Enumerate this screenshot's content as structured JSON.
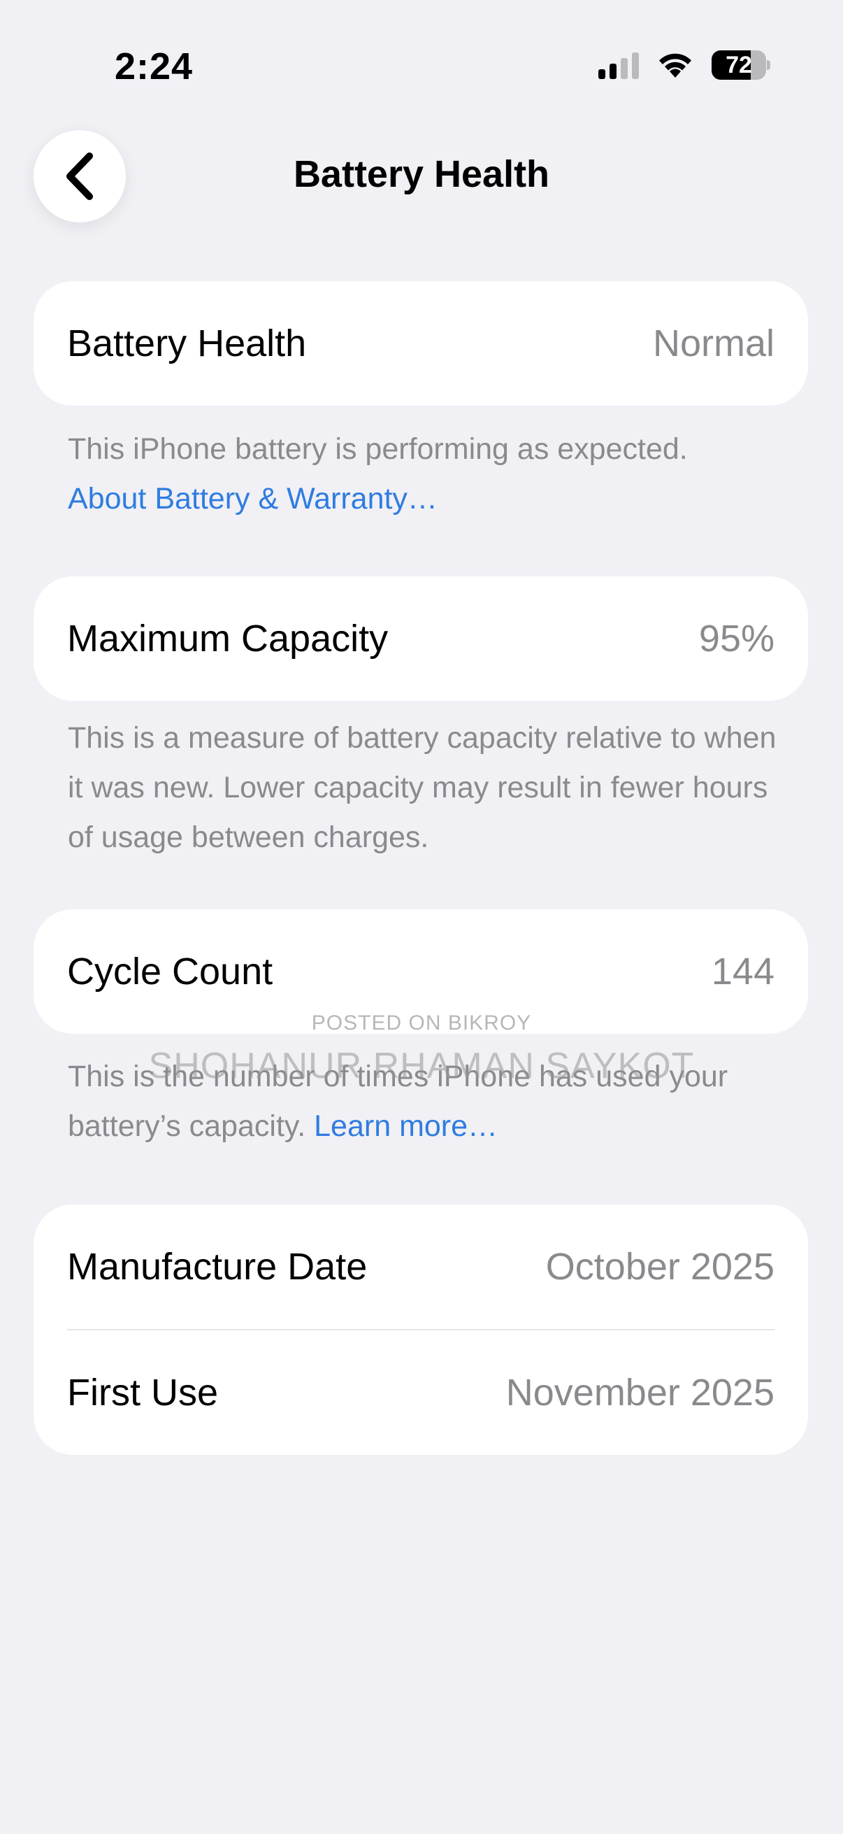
{
  "status_bar": {
    "time": "2:24",
    "battery_level": "72",
    "signal_bars": 4,
    "signal_active": 2
  },
  "nav": {
    "back_icon": "chevron-left-icon",
    "title": "Battery Health"
  },
  "battery_health": {
    "label": "Battery Health",
    "value": "Normal",
    "footnote": "This iPhone battery is performing as expected.",
    "link": "About Battery & Warranty…"
  },
  "max_capacity": {
    "label": "Maximum Capacity",
    "value": "95%",
    "footnote": "This is a measure of battery capacity relative to when it was new. Lower capacity may result in fewer hours of usage between charges."
  },
  "cycle_count": {
    "label": "Cycle Count",
    "value": "144",
    "footnote": "This is the number of times iPhone has used your battery’s capacity.",
    "link": "Learn more…"
  },
  "dates": {
    "manufacture_label": "Manufacture Date",
    "manufacture_value": "October 2025",
    "first_use_label": "First Use",
    "first_use_value": "November 2025"
  },
  "watermark": {
    "small": "POSTED ON BIKROY",
    "large": "SHOHANUR RHAMAN SAYKOT"
  },
  "colors": {
    "background": "#f0f0f5",
    "card": "#ffffff",
    "secondary_text": "#8a8a8e",
    "link": "#2f7ce0"
  }
}
